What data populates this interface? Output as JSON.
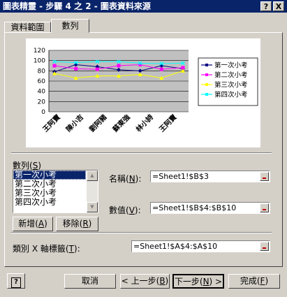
{
  "window": {
    "title": "圖表精靈 - 步驟 4 之 2 - 圖表資料來源",
    "help_btn": "?",
    "close_btn": "X"
  },
  "tabs": [
    {
      "label": "資料範圍"
    },
    {
      "label": "數列"
    }
  ],
  "chart_data": {
    "type": "line",
    "categories": [
      "王阿寶",
      "陳小吉",
      "劉阿豬",
      "蘇東強",
      "林小詩",
      "王阿寶"
    ],
    "ylim": [
      0,
      120
    ],
    "yticks": [
      "120",
      "100",
      "80",
      "60",
      "40",
      "20",
      "0"
    ],
    "grid": true,
    "legend_position": "right",
    "series": [
      {
        "name": "第一次小考",
        "color": "#000080",
        "marker": "diamond",
        "values": [
          78,
          92,
          88,
          82,
          80,
          90,
          84
        ]
      },
      {
        "name": "第二次小考",
        "color": "#ff00ff",
        "marker": "square",
        "values": [
          90,
          84,
          83,
          90,
          92,
          83,
          86
        ]
      },
      {
        "name": "第三次小考",
        "color": "#ffff00",
        "marker": "triangle",
        "values": [
          75,
          66,
          70,
          70,
          73,
          66,
          80
        ]
      },
      {
        "name": "第四次小考",
        "color": "#00ffff",
        "marker": "x",
        "values": [
          98,
          96,
          98,
          98,
          95,
          94,
          95
        ]
      }
    ]
  },
  "series_panel": {
    "label_pre": "數列(",
    "label_key": "S",
    "label_post": ")",
    "items": [
      "第一次小考",
      "第二次小考",
      "第三次小考",
      "第四次小考"
    ],
    "add_pre": "新增(",
    "add_key": "A",
    "add_post": ")",
    "remove_pre": "移除(",
    "remove_key": "R",
    "remove_post": ")",
    "name_pre": "名稱(",
    "name_key": "N",
    "name_post": "):",
    "name_value": "=Sheet1!$B$3",
    "values_pre": "數值(",
    "values_key": "V",
    "values_post": "):",
    "values_value": "=Sheet1!$B$4:$B$10"
  },
  "category": {
    "pre": "類別 X 軸標籤(",
    "key": "T",
    "post": "):",
    "value": "=Sheet1!$A$4:$A$10"
  },
  "footer": {
    "help_icon": "?",
    "cancel": "取消",
    "back_pre": "< 上一步(",
    "back_key": "B",
    "back_post": ")",
    "next_pre": "下一步(",
    "next_key": "N",
    "next_post": ") >",
    "finish_pre": "完成(",
    "finish_key": "F",
    "finish_post": ")"
  }
}
